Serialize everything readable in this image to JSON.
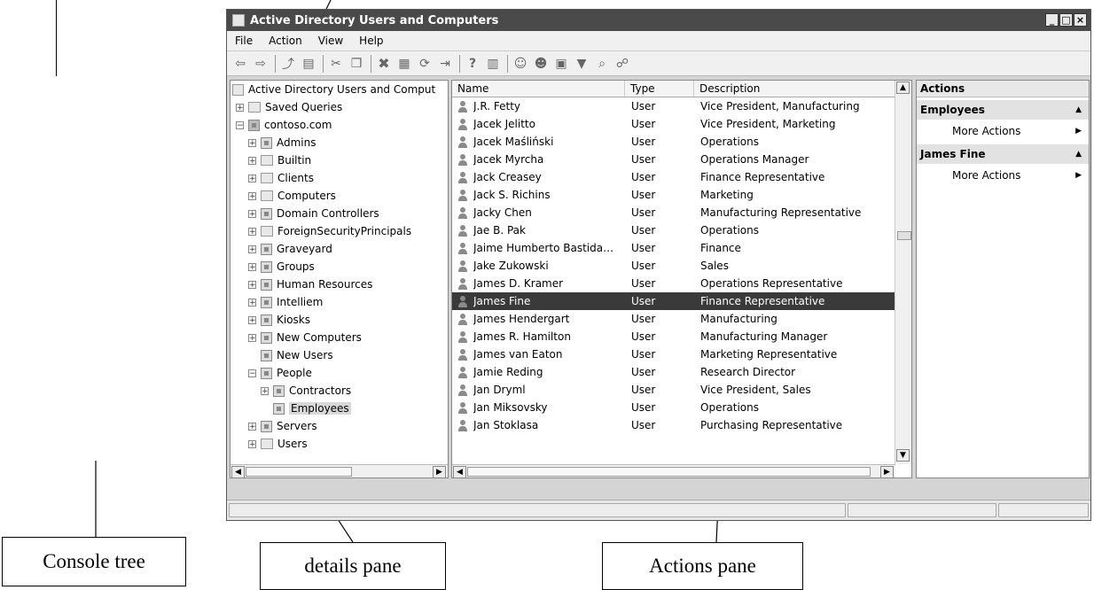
{
  "window": {
    "title": "Active Directory Users and Computers"
  },
  "window_buttons": {
    "minimize": "_",
    "maximize": "□",
    "close": "×"
  },
  "menu": [
    "File",
    "Action",
    "View",
    "Help"
  ],
  "tree": {
    "root": "Active Directory Users and Comput",
    "items": [
      {
        "label": "Saved Queries",
        "expander": "+",
        "icon": "folder-icon"
      },
      {
        "label": "contoso.com",
        "expander": "−",
        "icon": "domain-icon"
      },
      {
        "label": "Admins",
        "expander": "+",
        "icon": "ou-icon"
      },
      {
        "label": "Builtin",
        "expander": "+",
        "icon": "folder-icon"
      },
      {
        "label": "Clients",
        "expander": "+",
        "icon": "folder-icon"
      },
      {
        "label": "Computers",
        "expander": "+",
        "icon": "folder-icon"
      },
      {
        "label": "Domain Controllers",
        "expander": "+",
        "icon": "ou-icon"
      },
      {
        "label": "ForeignSecurityPrincipals",
        "expander": "+",
        "icon": "folder-icon"
      },
      {
        "label": "Graveyard",
        "expander": "+",
        "icon": "ou-icon"
      },
      {
        "label": "Groups",
        "expander": "+",
        "icon": "ou-icon"
      },
      {
        "label": "Human Resources",
        "expander": "+",
        "icon": "ou-icon"
      },
      {
        "label": "Intelliem",
        "expander": "+",
        "icon": "ou-icon"
      },
      {
        "label": "Kiosks",
        "expander": "+",
        "icon": "ou-icon"
      },
      {
        "label": "New Computers",
        "expander": "+",
        "icon": "ou-icon"
      },
      {
        "label": "New Users",
        "expander": "",
        "icon": "ou-icon"
      },
      {
        "label": "People",
        "expander": "−",
        "icon": "ou-icon"
      },
      {
        "label": "Contractors",
        "expander": "+",
        "icon": "ou-icon"
      },
      {
        "label": "Employees",
        "expander": "",
        "icon": "ou-icon",
        "selected": true
      },
      {
        "label": "Servers",
        "expander": "+",
        "icon": "ou-icon"
      },
      {
        "label": "Users",
        "expander": "+",
        "icon": "folder-icon"
      }
    ]
  },
  "details": {
    "columns": [
      "Name",
      "Type",
      "Description"
    ],
    "rows": [
      {
        "name": "J.R. Fetty",
        "type": "User",
        "description": "Vice President, Manufacturing"
      },
      {
        "name": "Jacek Jelitto",
        "type": "User",
        "description": "Vice President, Marketing"
      },
      {
        "name": "Jacek Maśliński",
        "type": "User",
        "description": "Operations"
      },
      {
        "name": "Jacek Myrcha",
        "type": "User",
        "description": "Operations Manager"
      },
      {
        "name": "Jack Creasey",
        "type": "User",
        "description": "Finance Representative"
      },
      {
        "name": "Jack S. Richins",
        "type": "User",
        "description": "Marketing"
      },
      {
        "name": "Jacky Chen",
        "type": "User",
        "description": "Manufacturing Representative"
      },
      {
        "name": "Jae B. Pak",
        "type": "User",
        "description": "Operations"
      },
      {
        "name": "Jaime Humberto Bastida…",
        "type": "User",
        "description": "Finance"
      },
      {
        "name": "Jake Zukowski",
        "type": "User",
        "description": "Sales"
      },
      {
        "name": "James D. Kramer",
        "type": "User",
        "description": "Operations Representative"
      },
      {
        "name": "James Fine",
        "type": "User",
        "description": "Finance Representative",
        "selected": true
      },
      {
        "name": "James Hendergart",
        "type": "User",
        "description": "Manufacturing"
      },
      {
        "name": "James R. Hamilton",
        "type": "User",
        "description": "Manufacturing Manager"
      },
      {
        "name": "James van Eaton",
        "type": "User",
        "description": "Marketing Representative"
      },
      {
        "name": "Jamie Reding",
        "type": "User",
        "description": "Research Director"
      },
      {
        "name": "Jan Dryml",
        "type": "User",
        "description": "Vice President, Sales"
      },
      {
        "name": "Jan Miksovsky",
        "type": "User",
        "description": "Operations"
      },
      {
        "name": "Jan Stoklasa",
        "type": "User",
        "description": "Purchasing Representative"
      }
    ]
  },
  "actions": {
    "title": "Actions",
    "sections": [
      {
        "title": "Employees",
        "item": "More Actions"
      },
      {
        "title": "James Fine",
        "item": "More Actions"
      }
    ]
  },
  "callouts": {
    "console_tree": "Console tree",
    "details_pane": "details pane",
    "actions_pane": "Actions pane"
  },
  "colors": {
    "titlebar": "#4a4a4a",
    "selection": "#3a3a3a"
  }
}
